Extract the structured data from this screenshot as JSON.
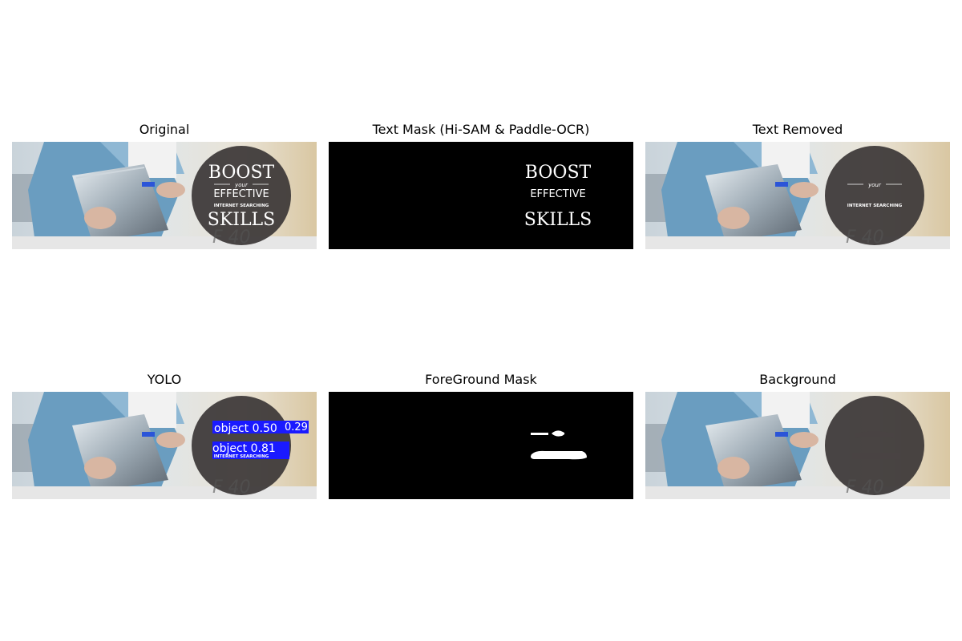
{
  "panels": [
    {
      "title": "Original"
    },
    {
      "title": "Text Mask (Hi-SAM & Paddle-OCR)"
    },
    {
      "title": "Text Removed"
    },
    {
      "title": "YOLO"
    },
    {
      "title": "ForeGround Mask"
    },
    {
      "title": "Background"
    }
  ],
  "banner": {
    "line1": "BOOST",
    "line2": "your",
    "line3": "EFFECTIVE",
    "line4": "INTERNET SEARCHING",
    "line5": "SKILLS",
    "mark": "F 40"
  },
  "detections": [
    {
      "label": "object 0.50",
      "score_tail": "0.29"
    },
    {
      "label": "object 0.81"
    }
  ],
  "colors": {
    "detection_box": "#1a1aff",
    "mask_bg": "#000000",
    "mask_fg": "#ffffff",
    "circle": "#3b3636"
  }
}
